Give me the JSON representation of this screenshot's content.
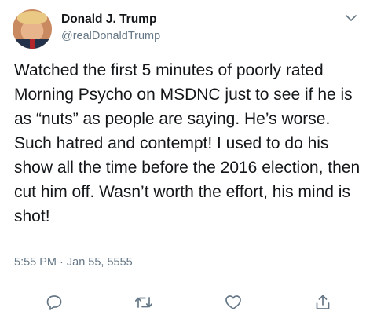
{
  "tweet": {
    "display_name": "Donald J. Trump",
    "handle": "@realDonaldTrump",
    "text": "Watched the first 5 minutes of poorly rated Morning Psycho on MSDNC just to see if he is as “nuts” as people are saying. He’s worse. Such hatred and contempt! I used to do his show all the time before the 2016 election, then cut him off. Wasn’t worth the effort, his mind is shot!",
    "timestamp": "5:55 PM · Jan 55, 5555"
  },
  "icons": {
    "more": "chevron-down-icon",
    "reply": "reply-icon",
    "retweet": "retweet-icon",
    "like": "heart-icon",
    "share": "share-icon"
  },
  "colors": {
    "text": "#14171a",
    "secondary": "#657786",
    "icon": "#657786",
    "divider": "#e6ecf0"
  }
}
